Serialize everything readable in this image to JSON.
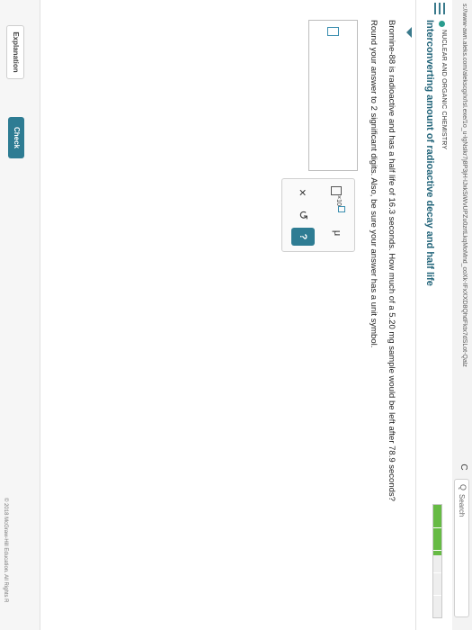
{
  "browser": {
    "url": "s://www-awn.aleks.com/alekscgi/x/Isl.exe/1o_u-lgNslkr7j8P3jH-lJxkSiWvUPZu0zrtLkqMoMnd_coXk-IFxXXD8QhdFktx7dSLot-Qalz",
    "reload_icon": "C",
    "search_icon": "Q",
    "search_placeholder": "Search"
  },
  "header": {
    "subject": "NUCLEAR AND ORGANIC CHEMISTRY",
    "title": "Interconverting amount of radioactive decay and half life",
    "progress": 0.45,
    "accent_color": "#23657a",
    "progress_color": "#66bb44"
  },
  "question": {
    "line1": "Bromine-88 is radioactive and has a half life of 16.3 seconds. How much of a 5.20 mg sample would be left after 78.9 seconds?",
    "line2": "Round your answer to 2 significant digits. Also, be sure your answer has a unit symbol."
  },
  "keypad": {
    "sci_label": "×10",
    "mu_label": "μ",
    "clear_label": "×",
    "undo_label": "↺",
    "help_label": "?"
  },
  "footer": {
    "explanation_label": "Explanation",
    "check_label": "Check",
    "copyright": "© 2018 McGraw-Hill Education. All Rights R"
  }
}
